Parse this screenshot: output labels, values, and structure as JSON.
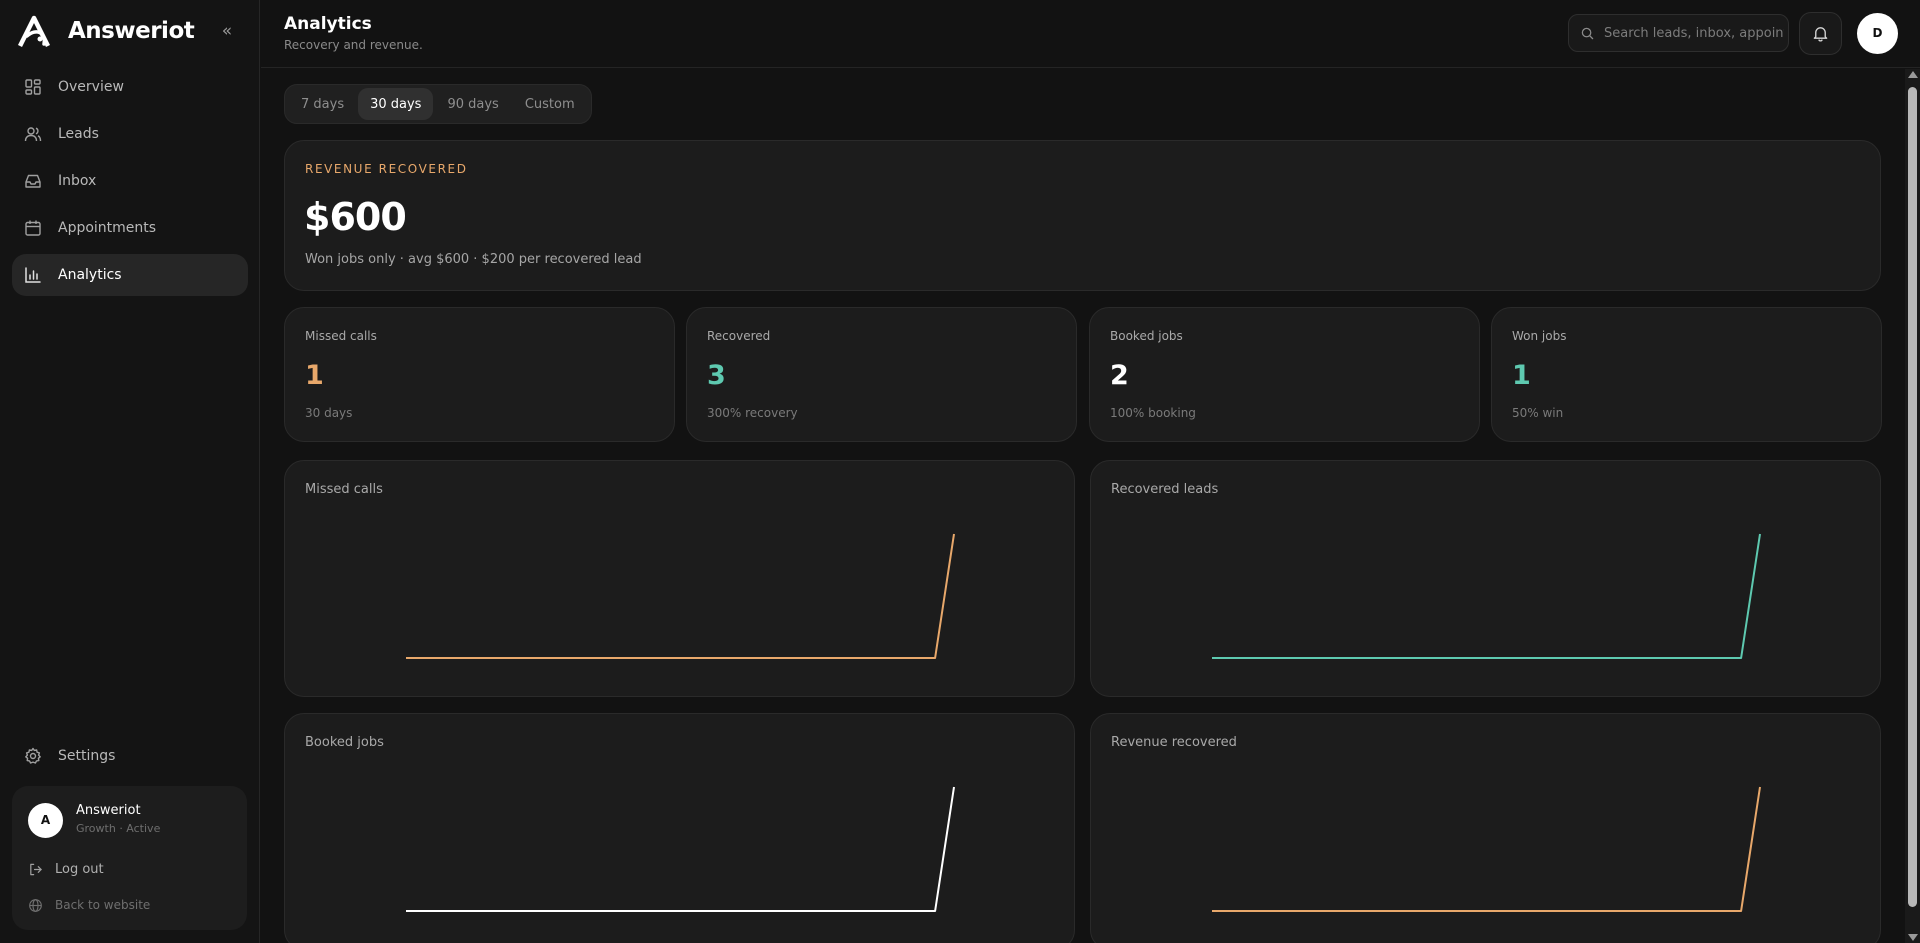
{
  "brand": {
    "name": "Answeriot"
  },
  "sidebar": {
    "collapse_label": "«",
    "items": [
      {
        "label": "Overview",
        "icon": "grid-icon"
      },
      {
        "label": "Leads",
        "icon": "users-icon"
      },
      {
        "label": "Inbox",
        "icon": "inbox-icon"
      },
      {
        "label": "Appointments",
        "icon": "calendar-icon"
      },
      {
        "label": "Analytics",
        "icon": "bar-chart-icon",
        "active": true
      }
    ],
    "settings_label": "Settings"
  },
  "account": {
    "initial": "A",
    "name": "Answeriot",
    "plan": "Growth · Active",
    "logout_label": "Log out",
    "back_label": "Back to website"
  },
  "header": {
    "title": "Analytics",
    "subtitle": "Recovery and revenue.",
    "search_placeholder": "Search leads, inbox, appointments",
    "user_initial": "D"
  },
  "range": {
    "options": [
      "7 days",
      "30 days",
      "90 days",
      "Custom"
    ],
    "selected": "30 days"
  },
  "revenue": {
    "label": "REVENUE RECOVERED",
    "value": "$600",
    "description": "Won jobs only · avg $600 · $200 per recovered lead"
  },
  "stats": [
    {
      "label": "Missed calls",
      "value": "1",
      "sub": "30 days",
      "color": "#e8a86b"
    },
    {
      "label": "Recovered",
      "value": "3",
      "sub": "300% recovery",
      "color": "#5ec9b0"
    },
    {
      "label": "Booked jobs",
      "value": "2",
      "sub": "100% booking",
      "color": "#ffffff"
    },
    {
      "label": "Won jobs",
      "value": "1",
      "sub": "50% win",
      "color": "#5ec9b0"
    }
  ],
  "colors": {
    "orange": "#e8a86b",
    "teal": "#5ec9b0",
    "white": "#ffffff"
  },
  "chart_data": [
    {
      "type": "line",
      "title": "Missed calls",
      "color": "#e8a86b",
      "values": [
        0,
        0,
        0,
        0,
        0,
        0,
        0,
        0,
        0,
        0,
        0,
        0,
        0,
        0,
        0,
        0,
        0,
        0,
        0,
        0,
        0,
        0,
        0,
        0,
        0,
        0,
        0,
        0,
        0,
        1
      ]
    },
    {
      "type": "line",
      "title": "Recovered leads",
      "color": "#5ec9b0",
      "values": [
        0,
        0,
        0,
        0,
        0,
        0,
        0,
        0,
        0,
        0,
        0,
        0,
        0,
        0,
        0,
        0,
        0,
        0,
        0,
        0,
        0,
        0,
        0,
        0,
        0,
        0,
        0,
        0,
        0,
        3
      ]
    },
    {
      "type": "line",
      "title": "Booked jobs",
      "color": "#ffffff",
      "values": [
        0,
        0,
        0,
        0,
        0,
        0,
        0,
        0,
        0,
        0,
        0,
        0,
        0,
        0,
        0,
        0,
        0,
        0,
        0,
        0,
        0,
        0,
        0,
        0,
        0,
        0,
        0,
        0,
        0,
        2
      ]
    },
    {
      "type": "line",
      "title": "Revenue recovered",
      "color": "#e8a86b",
      "values": [
        0,
        0,
        0,
        0,
        0,
        0,
        0,
        0,
        0,
        0,
        0,
        0,
        0,
        0,
        0,
        0,
        0,
        0,
        0,
        0,
        0,
        0,
        0,
        0,
        0,
        0,
        0,
        0,
        0,
        600
      ]
    }
  ]
}
